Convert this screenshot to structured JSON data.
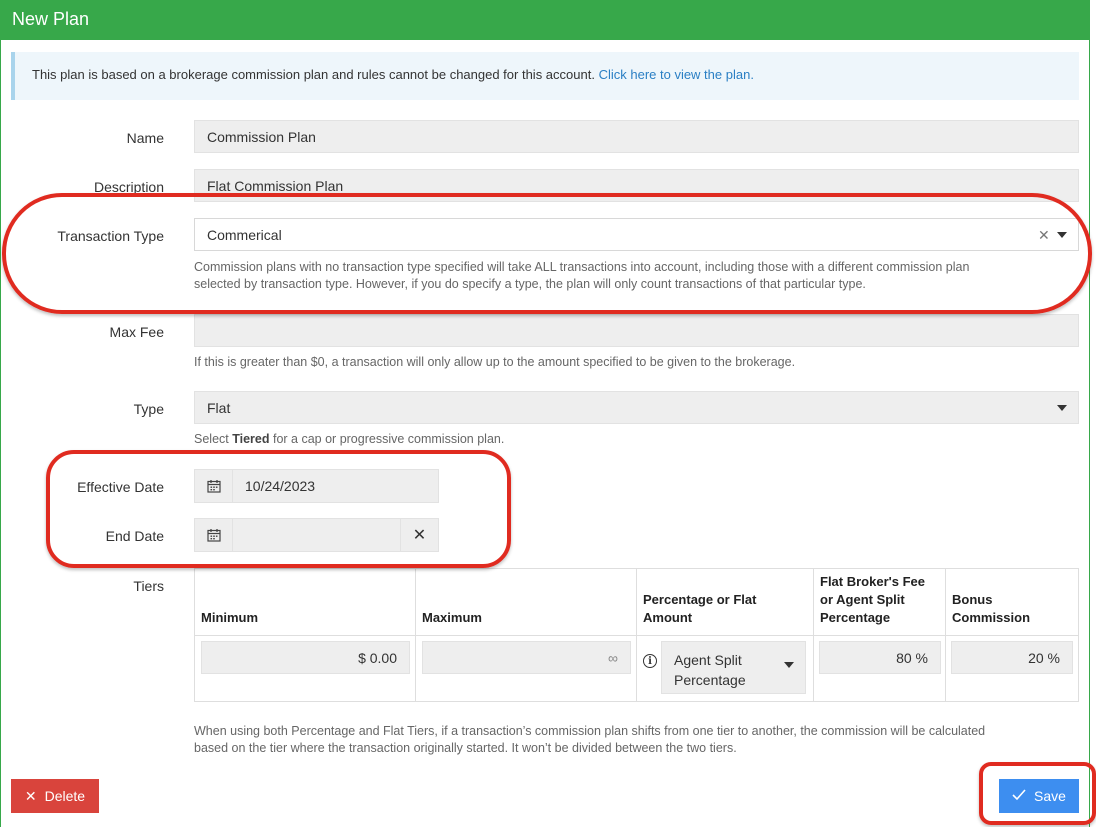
{
  "header": {
    "title": "New Plan"
  },
  "notice": {
    "text": "This plan is based on a brokerage commission plan and rules cannot be changed for this account.",
    "link": "Click here to view the plan."
  },
  "form": {
    "name": {
      "label": "Name",
      "value": "Commission Plan"
    },
    "description": {
      "label": "Description",
      "value": "Flat Commission Plan"
    },
    "transaction_type": {
      "label": "Transaction Type",
      "value": "Commerical",
      "help_line1": "Commission plans with no transaction type specified will take ALL transactions into account, including those with a different commission plan",
      "help_line2": "selected by transaction type. However, if you do specify a type, the plan will only count transactions of that particular type."
    },
    "max_fee": {
      "label": "Max Fee",
      "value": "",
      "help": "If this is greater than $0, a transaction will only allow up to the amount specified to be given to the brokerage."
    },
    "type": {
      "label": "Type",
      "value": "Flat",
      "help_prefix": "Select ",
      "help_bold": "Tiered",
      "help_suffix": " for a cap or progressive commission plan."
    },
    "effective_date": {
      "label": "Effective Date",
      "value": "10/24/2023"
    },
    "end_date": {
      "label": "End Date",
      "value": ""
    },
    "tiers": {
      "label": "Tiers",
      "columns": {
        "minimum": "Minimum",
        "maximum": "Maximum",
        "pct_flat_line1": "Percentage or Flat",
        "pct_flat_line2": "Amount",
        "broker_line1": "Flat Broker's Fee",
        "broker_line2": "or Agent Split",
        "broker_line3": "Percentage",
        "bonus_line1": "Bonus",
        "bonus_line2": "Commission"
      },
      "row": {
        "minimum": "$ 0.00",
        "maximum": "∞",
        "split_line1": "Agent Split",
        "split_line2": "Percentage",
        "broker_fee": "80 %",
        "bonus": "20 %"
      },
      "note_line1": "When using both Percentage and Flat Tiers, if a transaction’s commission plan shifts from one tier to another, the commission will be calculated",
      "note_line2": "based on the tier where the transaction originally started. It won’t be divided between the two tiers."
    }
  },
  "actions": {
    "delete": "Delete",
    "save": "Save"
  },
  "icons": {
    "clear": "close-icon",
    "dropdown": "caret-down-icon",
    "calendar": "calendar-icon",
    "info": "info-icon",
    "check": "check-icon"
  },
  "colors": {
    "header": "#37a84a",
    "delete": "#d9443c",
    "save": "#3d8ef0",
    "highlight": "#e02b20",
    "link": "#2a7fc4"
  }
}
